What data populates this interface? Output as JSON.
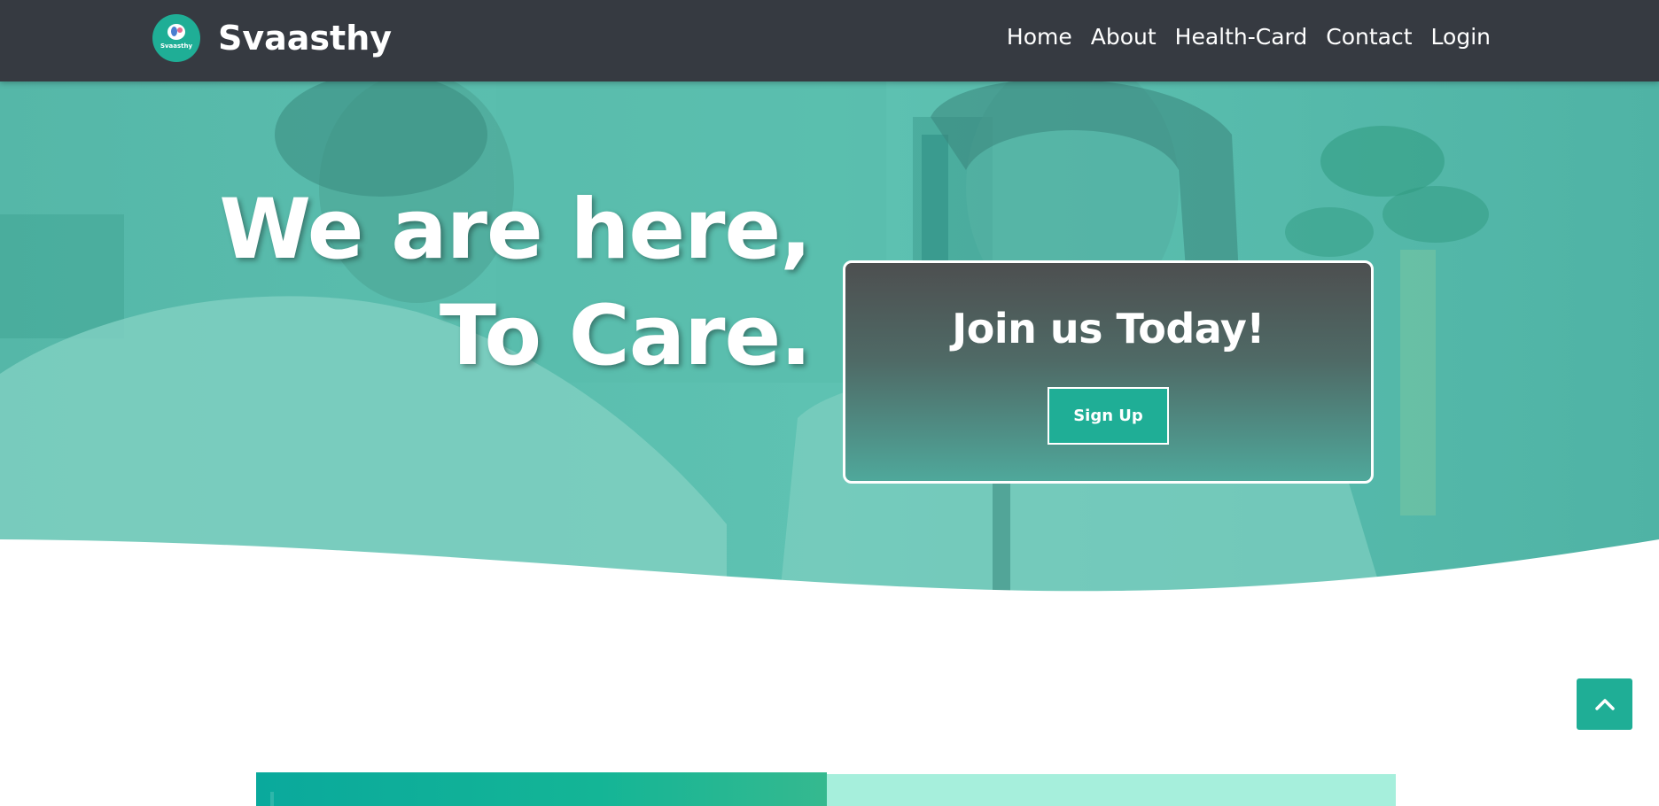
{
  "brand": {
    "name": "Svaasthy",
    "logo_text": "Svaasthy"
  },
  "nav": {
    "links": [
      "Home",
      "About",
      "Health-Card",
      "Contact",
      "Login"
    ]
  },
  "hero": {
    "title_line1": "We are here,",
    "title_line2": "To Care."
  },
  "join_card": {
    "title": "Join us Today!",
    "signup_label": "Sign Up"
  },
  "icons": {
    "scroll_top": "chevron-up-icon",
    "logo": "heart-logo-icon"
  },
  "colors": {
    "navbar": "#363a41",
    "accent": "#1fae96",
    "hero_overlay": "#5fc0b1",
    "panel_light": "#a6efdc"
  }
}
